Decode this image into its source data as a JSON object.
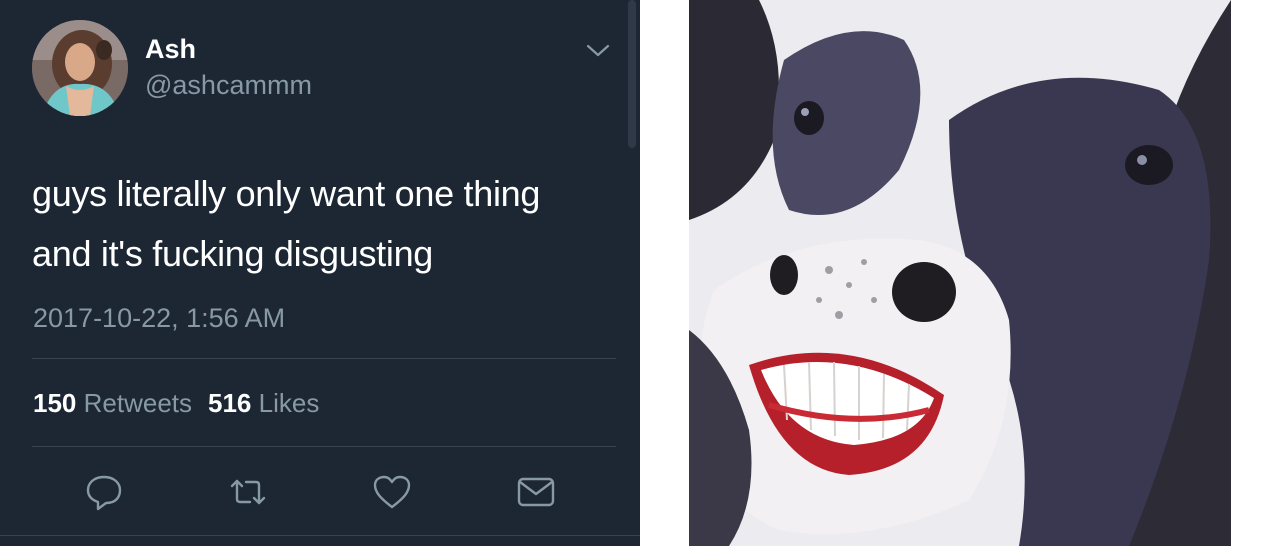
{
  "tweet": {
    "display_name": "Ash",
    "handle": "@ashcammm",
    "text_line_1": "guys literally only want one thing",
    "text_line_2": "and it's fucking disgusting",
    "timestamp": "2017-10-22, 1:56 AM",
    "retweets_count": "150",
    "retweets_label": "Retweets",
    "likes_count": "516",
    "likes_label": "Likes"
  },
  "icons": {
    "menu": "chevron-down-icon",
    "reply": "reply-icon",
    "retweet": "retweet-icon",
    "like": "heart-icon",
    "dm": "envelope-icon"
  },
  "colors": {
    "background": "#1c2733",
    "secondary_text": "#8899a6",
    "primary_text": "#ffffff",
    "divider": "#38444d"
  }
}
